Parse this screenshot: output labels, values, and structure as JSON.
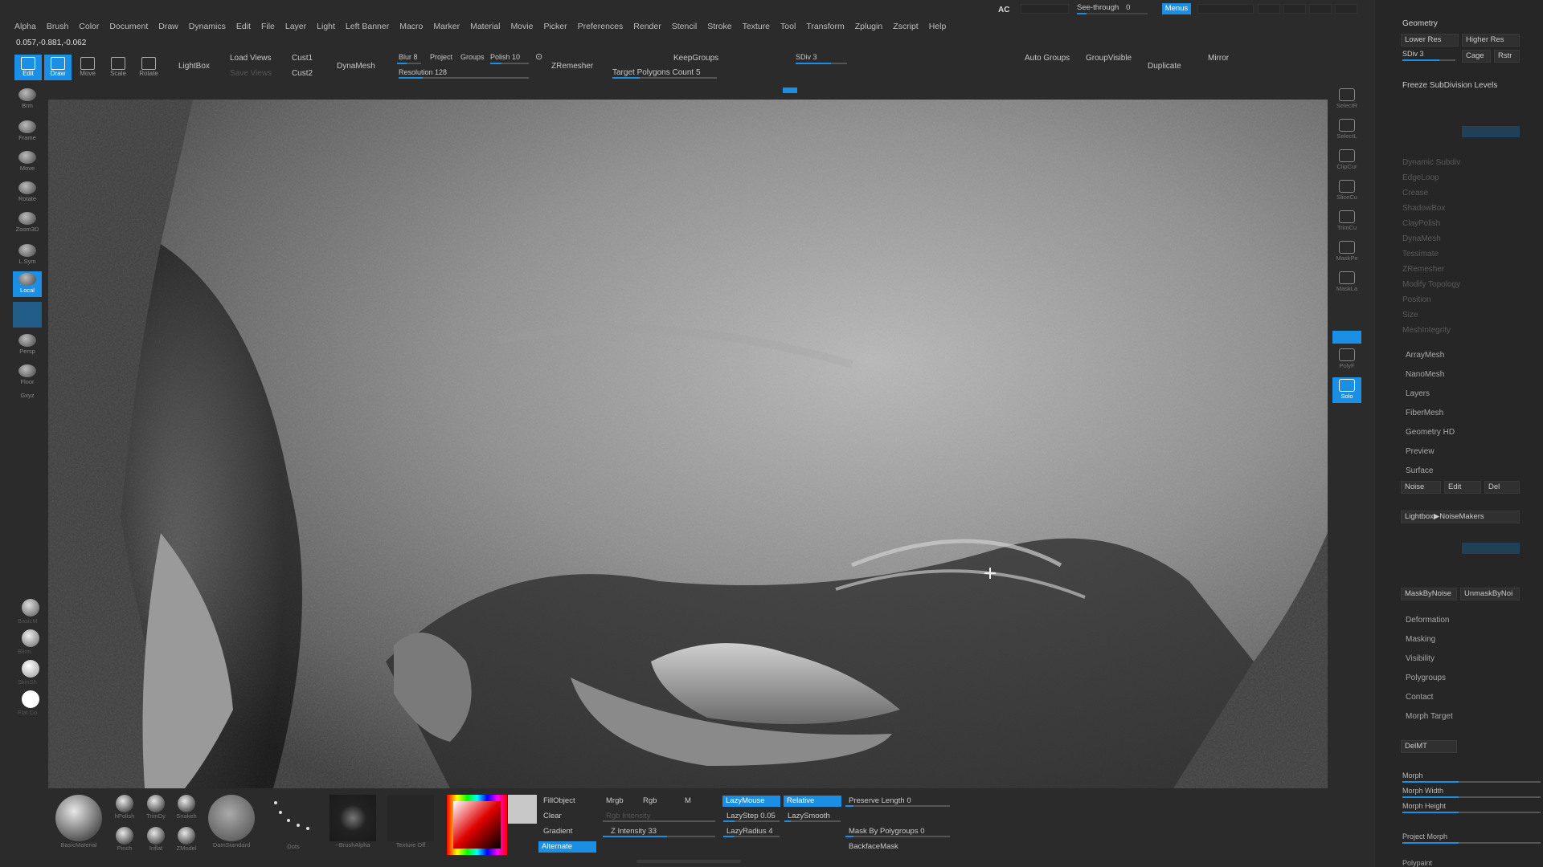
{
  "menu": [
    "Alpha",
    "Brush",
    "Color",
    "Document",
    "Draw",
    "Dynamics",
    "Edit",
    "File",
    "Layer",
    "Light",
    "Left Banner",
    "Macro",
    "Marker",
    "Material",
    "Movie",
    "Picker",
    "Preferences",
    "Render",
    "Stencil",
    "Stroke",
    "Texture",
    "Tool",
    "Transform",
    "Zplugin",
    "Zscript",
    "Help"
  ],
  "coords": "0.057,-0.881,-0.062",
  "top": {
    "ac": "AC",
    "seethrough": "See-through",
    "seethrough_value": "0",
    "menus": "Menus"
  },
  "toolbar": {
    "edit": "Edit",
    "draw": "Draw",
    "move": "Move",
    "scale": "Scale",
    "rotate": "Rotate",
    "lightbox": "LightBox",
    "load_views": "Load Views",
    "save_views": "Save Views",
    "cust1": "Cust1",
    "cust2": "Cust2",
    "dynamesh": "DynaMesh",
    "blur": "Blur",
    "blur_value": "8",
    "project": "Project",
    "groups": "Groups",
    "polish": "Polish",
    "polish_value": "10",
    "resolution": "Resolution",
    "resolution_value": "128",
    "zremesher": "ZRemesher",
    "keepgroups": "KeepGroups",
    "target_polygons": "Target Polygons Count",
    "target_polygons_value": "5",
    "sdiv": "SDiv",
    "sdiv_value": "3",
    "auto_groups": "Auto Groups",
    "groupvisible": "GroupVisible",
    "duplicate": "Duplicate",
    "mirror": "Mirror"
  },
  "left_shelf": [
    "Brm",
    "Frame",
    "Move",
    "Rotate",
    "Zoom3D",
    "L.Sym",
    "Local",
    "",
    "Persp",
    "Floor",
    "Gxyz"
  ],
  "left_materials": [
    "BasicM",
    "Blinn",
    "SkinSh",
    "Flat Co"
  ],
  "right_shelf": [
    "SelectR",
    "SelectL",
    "ClipCur",
    "SliceCu",
    "TrimCu",
    "MaskPe",
    "MaskLa",
    "",
    "PolyF",
    "Solo"
  ],
  "geometry": {
    "title": "Geometry",
    "lower_res": "Lower Res",
    "higher_res": "Higher Res",
    "sdiv": "SDiv",
    "sdiv_value": "3",
    "cage": "Cage",
    "rstr": "Rstr",
    "freeze": "Freeze SubDivision Levels",
    "items": [
      "Dynamic Subdiv",
      "EdgeLoop",
      "Crease",
      "ShadowBox",
      "ClayPolish",
      "DynaMesh",
      "Tessimate",
      "ZRemesher",
      "Modify Topology",
      "Position",
      "Size",
      "MeshIntegrity"
    ]
  },
  "subpalettes": [
    "ArrayMesh",
    "NanoMesh",
    "Layers",
    "FiberMesh",
    "Geometry HD",
    "Preview",
    "Surface"
  ],
  "surface": {
    "noise": "Noise",
    "edit": "Edit",
    "del": "Del",
    "lightbox_noise": "Lightbox▶NoiseMakers",
    "mask_by_noise": "MaskByNoise",
    "unmask_by_noise": "UnmaskByNoi"
  },
  "subpalettes2": [
    "Deformation",
    "Masking",
    "Visibility",
    "Polygroups",
    "Contact",
    "Morph Target"
  ],
  "morph": {
    "delmt": "DelMT",
    "morph": "Morph",
    "morph_width": "Morph Width",
    "morph_height": "Morph Height",
    "project_morph": "Project Morph",
    "polypaint": "Polypaint"
  },
  "bottom": {
    "basic_material": "BasicMaterial",
    "brushes": [
      [
        "hPolish",
        "TrimDy",
        "Snakeh"
      ],
      [
        "Pinch",
        "Inflat",
        "ZModel"
      ]
    ],
    "damstandard": "DamStandard",
    "stroke": "Dots",
    "alpha": "~BrushAlpha",
    "texture": "Texture Off",
    "fillobject": "FillObject",
    "clear": "Clear",
    "gradient": "Gradient",
    "alternate": "Alternate",
    "mrgb": "Mrgb",
    "rgb": "Rgb",
    "m": "M",
    "rgb_intensity": "Rgb Intensity",
    "z_intensity": "Z Intensity",
    "z_intensity_value": "33",
    "lazymouse": "LazyMouse",
    "relative": "Relative",
    "lazystep": "LazyStep",
    "lazystep_value": "0.05",
    "lazysmooth": "LazySmooth",
    "lazyradius": "LazyRadius",
    "lazyradius_value": "4",
    "preserve_length": "Preserve Length",
    "preserve_length_value": "0",
    "mask_by_polygroups": "Mask By Polygroups",
    "mask_by_polygroups_value": "0",
    "backface_mask": "BackfaceMask"
  },
  "colors": {
    "accent": "#1a8fe3",
    "panel": "#2b2b2b",
    "viewport": "#3d3d3d"
  }
}
